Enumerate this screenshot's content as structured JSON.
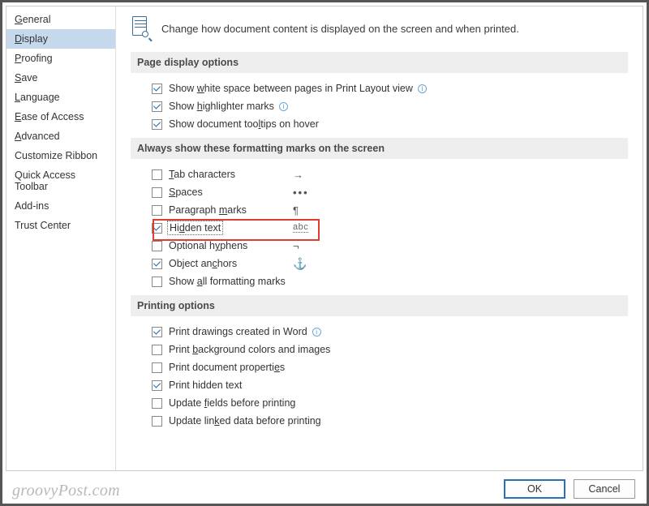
{
  "sidebar": {
    "items": [
      {
        "label": "General",
        "u": "G",
        "rest": "eneral"
      },
      {
        "label": "Display",
        "u": "D",
        "rest": "isplay"
      },
      {
        "label": "Proofing",
        "u": "P",
        "rest": "roofing"
      },
      {
        "label": "Save",
        "u": "S",
        "rest": "ave"
      },
      {
        "label": "Language",
        "u": "L",
        "rest": "anguage"
      },
      {
        "label": "Ease of Access",
        "u": "E",
        "rest": "ase of Access"
      },
      {
        "label": "Advanced",
        "u": "A",
        "rest": "dvanced"
      },
      {
        "label": "Customize Ribbon",
        "u": "",
        "rest": "Customize Ribbon"
      },
      {
        "label": "Quick Access Toolbar",
        "u": "",
        "rest": "Quick Access Toolbar"
      },
      {
        "label": "Add-ins",
        "u": "",
        "rest": "Add-ins"
      },
      {
        "label": "Trust Center",
        "u": "",
        "rest": "Trust Center"
      }
    ],
    "selected_index": 1
  },
  "header": {
    "text": "Change how document content is displayed on the screen and when printed."
  },
  "sections": {
    "page_display": {
      "title": "Page display options",
      "whitespace_pre": "Show ",
      "whitespace_u": "w",
      "whitespace_post": "hite space between pages in Print Layout view",
      "highlighter_pre": "Show ",
      "highlighter_u": "h",
      "highlighter_post": "ighlighter marks",
      "tooltips_pre": "Show document too",
      "tooltips_u": "l",
      "tooltips_post": "tips on hover"
    },
    "marks": {
      "title": "Always show these formatting marks on the screen",
      "tab_u": "T",
      "tab_post": "ab characters",
      "tab_sym": "→",
      "spaces_u": "S",
      "spaces_post": "paces",
      "spaces_sym": "•••",
      "para_pre": "Paragraph ",
      "para_u": "m",
      "para_post": "arks",
      "para_sym": "¶",
      "hidden_pre": "Hi",
      "hidden_u": "d",
      "hidden_post": "den text",
      "hidden_sym": "abc",
      "hyphens_pre": "Optional h",
      "hyphens_u": "y",
      "hyphens_post": "phens",
      "hyphens_sym": "¬",
      "anchors_pre": "Object an",
      "anchors_u": "c",
      "anchors_post": "hors",
      "anchors_sym": "⚓",
      "all_pre": "Show ",
      "all_u": "a",
      "all_post": "ll formatting marks"
    },
    "printing": {
      "title": "Printing options",
      "drawings": "Print drawings created in Word",
      "bg_pre": "Print ",
      "bg_u": "b",
      "bg_post": "ackground colors and images",
      "props_pre": "Print document properti",
      "props_u": "e",
      "props_post": "s",
      "hiddentext": "Print hidden text",
      "update_pre": "Update ",
      "update_u": "f",
      "update_post": "ields before printing",
      "linked_pre": "Update lin",
      "linked_u": "k",
      "linked_post": "ed data before printing"
    }
  },
  "buttons": {
    "ok": "OK",
    "cancel": "Cancel"
  },
  "watermark": "groovyPost.com",
  "info_glyph": "i"
}
